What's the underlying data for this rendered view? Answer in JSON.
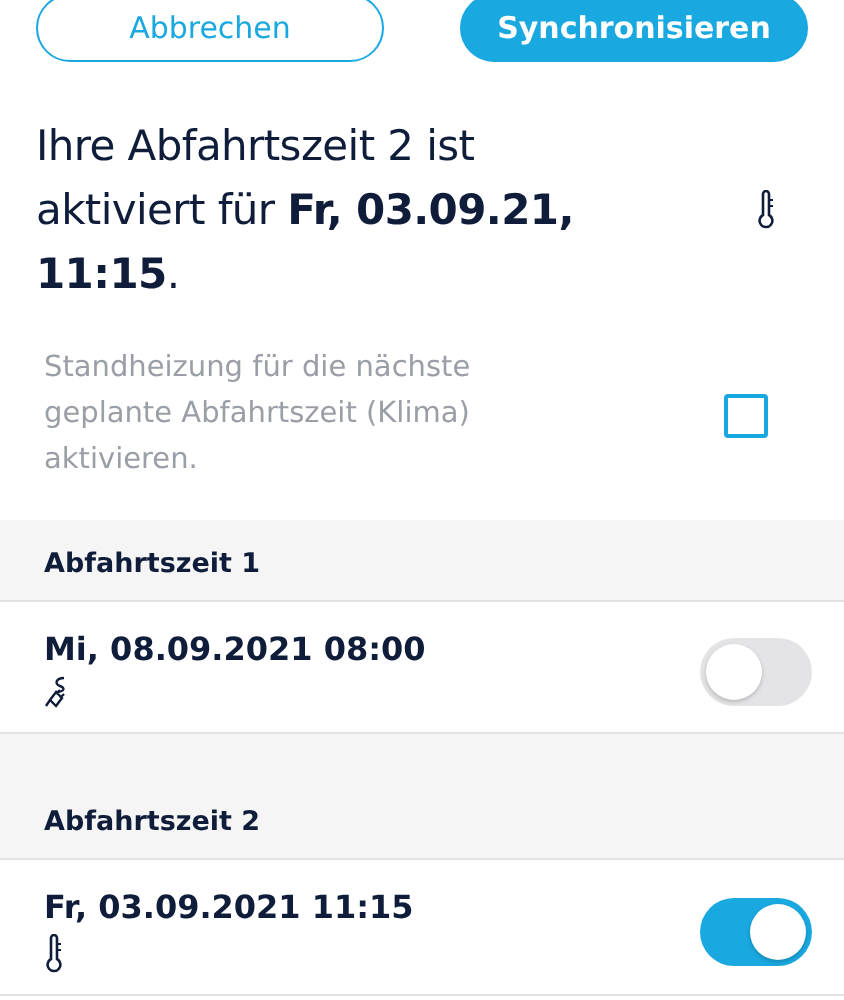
{
  "buttons": [
    {
      "label": "Abbrechen",
      "kind": "outline"
    },
    {
      "label": "Synchronisieren",
      "kind": "filled"
    }
  ],
  "headline": {
    "text": "Ihre Abfahrtszeit 2 ist aktiviert für **Fr, 03.09.21, 11:15**.",
    "kind": "thermometer"
  },
  "preheat": {
    "label": "Standheizung für die nächste geplante Abfahrtszeit (Klima) aktivieren.",
    "checked": false
  },
  "departures": [
    {
      "heading": "Abfahrtszeit 1",
      "datetime": "Mi, 08.09.2021 08:00",
      "kind": "plug",
      "on": false
    },
    {
      "heading": "Abfahrtszeit 2",
      "datetime": "Fr, 03.09.2021 11:15",
      "kind": "thermometer",
      "on": true
    }
  ]
}
